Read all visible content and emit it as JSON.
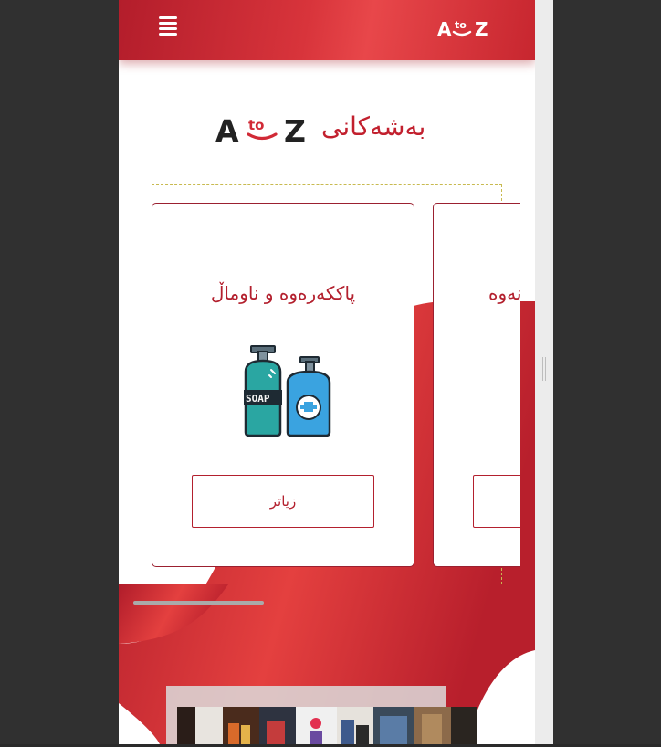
{
  "header": {
    "menu_icon": "hamburger-menu-icon",
    "logo_icon": "atoz-logo-icon",
    "logo_letters": [
      "A",
      "to",
      "Z"
    ],
    "colors": {
      "primary": "#c2202e",
      "gradient_light": "#e8474a"
    }
  },
  "section": {
    "logo_icon": "atoz-logo-icon",
    "logo_letters": [
      "A",
      "to",
      "Z"
    ],
    "title": "بەشەکانی"
  },
  "cards": [
    {
      "title": "پاککەرەوە و ناوماڵ",
      "image_icon": "soap-bottles-icon",
      "button_label": "زیاتر"
    },
    {
      "title": "نەوە",
      "image_icon": "",
      "button_label": ""
    }
  ],
  "carousel": {
    "scroll_position": 0.0
  },
  "bottom": {
    "image_icon": "clothing-store-photo"
  }
}
